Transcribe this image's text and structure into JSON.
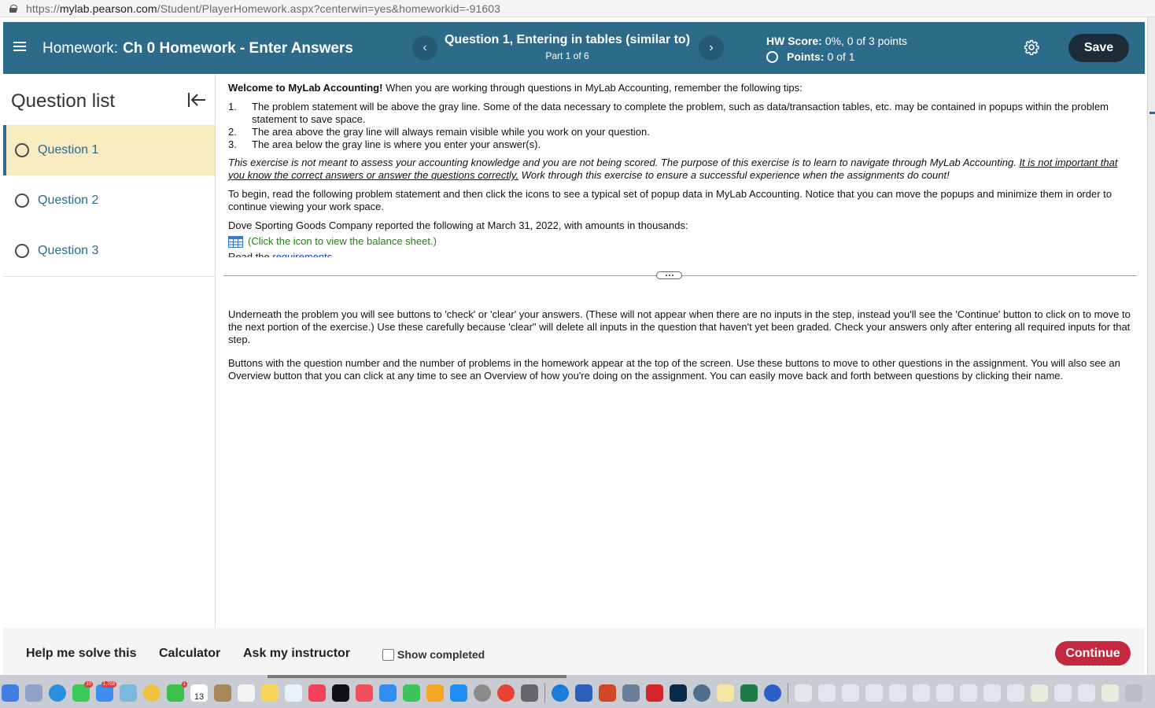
{
  "browser": {
    "url_prefix": "https://",
    "url_host": "mylab.pearson.com",
    "url_path": "/Student/PlayerHomework.aspx?centerwin=yes&homeworkid=-91603"
  },
  "header": {
    "homework_label": "Homework:",
    "homework_name": "Ch 0 Homework - Enter Answers",
    "prev_symbol": "‹",
    "next_symbol": "›",
    "question_title": "Question 1, Entering in tables (similar to)",
    "question_part": "Part 1 of 6",
    "hw_score_label": "HW Score:",
    "hw_score_value": "0%, 0 of 3 points",
    "points_label": "Points:",
    "points_value": "0 of 1",
    "save_label": "Save"
  },
  "sidebar": {
    "title": "Question list",
    "items": [
      {
        "label": "Question 1"
      },
      {
        "label": "Question 2"
      },
      {
        "label": "Question 3"
      }
    ]
  },
  "problem": {
    "welcome_bold": "Welcome to MyLab Accounting!",
    "welcome_rest": " When you are working through questions in MyLab Accounting, remember the following tips:",
    "tips": [
      {
        "num": "1.",
        "text": "The problem statement will be above the gray line. Some of the data necessary to complete the problem, such as data/transaction tables, etc. may be contained in popups within the problem statement to save space."
      },
      {
        "num": "2.",
        "text": "The area above the gray line will always remain visible while you work on your question."
      },
      {
        "num": "3.",
        "text": "The area below the gray line is where you enter your answer(s)."
      }
    ],
    "italic_part1": "This exercise is not meant to assess your accounting knowledge and you are not being scored. The purpose of this exercise is to learn to navigate through MyLab Accounting. ",
    "italic_underlined": "It is not important that you know the correct answers or answer the questions correctly.",
    "italic_part2": " Work through this exercise to ensure a successful experience when the assignments do count!",
    "begin_text": "To begin, read the following problem statement and then click the icons to see a typical set of popup data in MyLab Accounting. Notice that you can move the popups and minimize them in order to continue viewing your work space.",
    "company_text": "Dove Sporting Goods Company reported the following at March 31, 2022, with amounts in thousands:",
    "balance_sheet_link": "(Click the icon to view the balance sheet.)",
    "read_prefix": "Read the ",
    "read_link": "requirements"
  },
  "answer_area": {
    "para1": "Underneath the problem you will see buttons to 'check' or 'clear' your answers. (These will not appear when there are no inputs in the step, instead you'll see the 'Continue' button to click on to move to the next portion of the exercise.) Use these carefully because 'clear\" will delete all inputs in the question that haven't yet been graded. Check your answers only after entering all required inputs for that step.",
    "para2": "Buttons with the question number and the number of problems in the homework appear at the top of the screen. Use these buttons to move to other questions in the assignment. You will also see an Overview button that you can click at any time to see an Overview of how you're doing on the assignment. You can easily move back and forth between questions by clicking their name."
  },
  "footer": {
    "help_label": "Help me solve this",
    "calculator_label": "Calculator",
    "ask_label": "Ask my instructor",
    "show_completed_label": "Show completed",
    "continue_label": "Continue"
  },
  "dock": {
    "calendar_day": "13",
    "badges": {
      "facetime": "10",
      "mail": "1,703",
      "messages": "1"
    }
  },
  "colors": {
    "header": "#2d6b8a",
    "active_question": "#f8ebc0",
    "save_button": "#1d2c38",
    "continue_button": "#c5283e",
    "link_green": "#2a7d1b"
  }
}
